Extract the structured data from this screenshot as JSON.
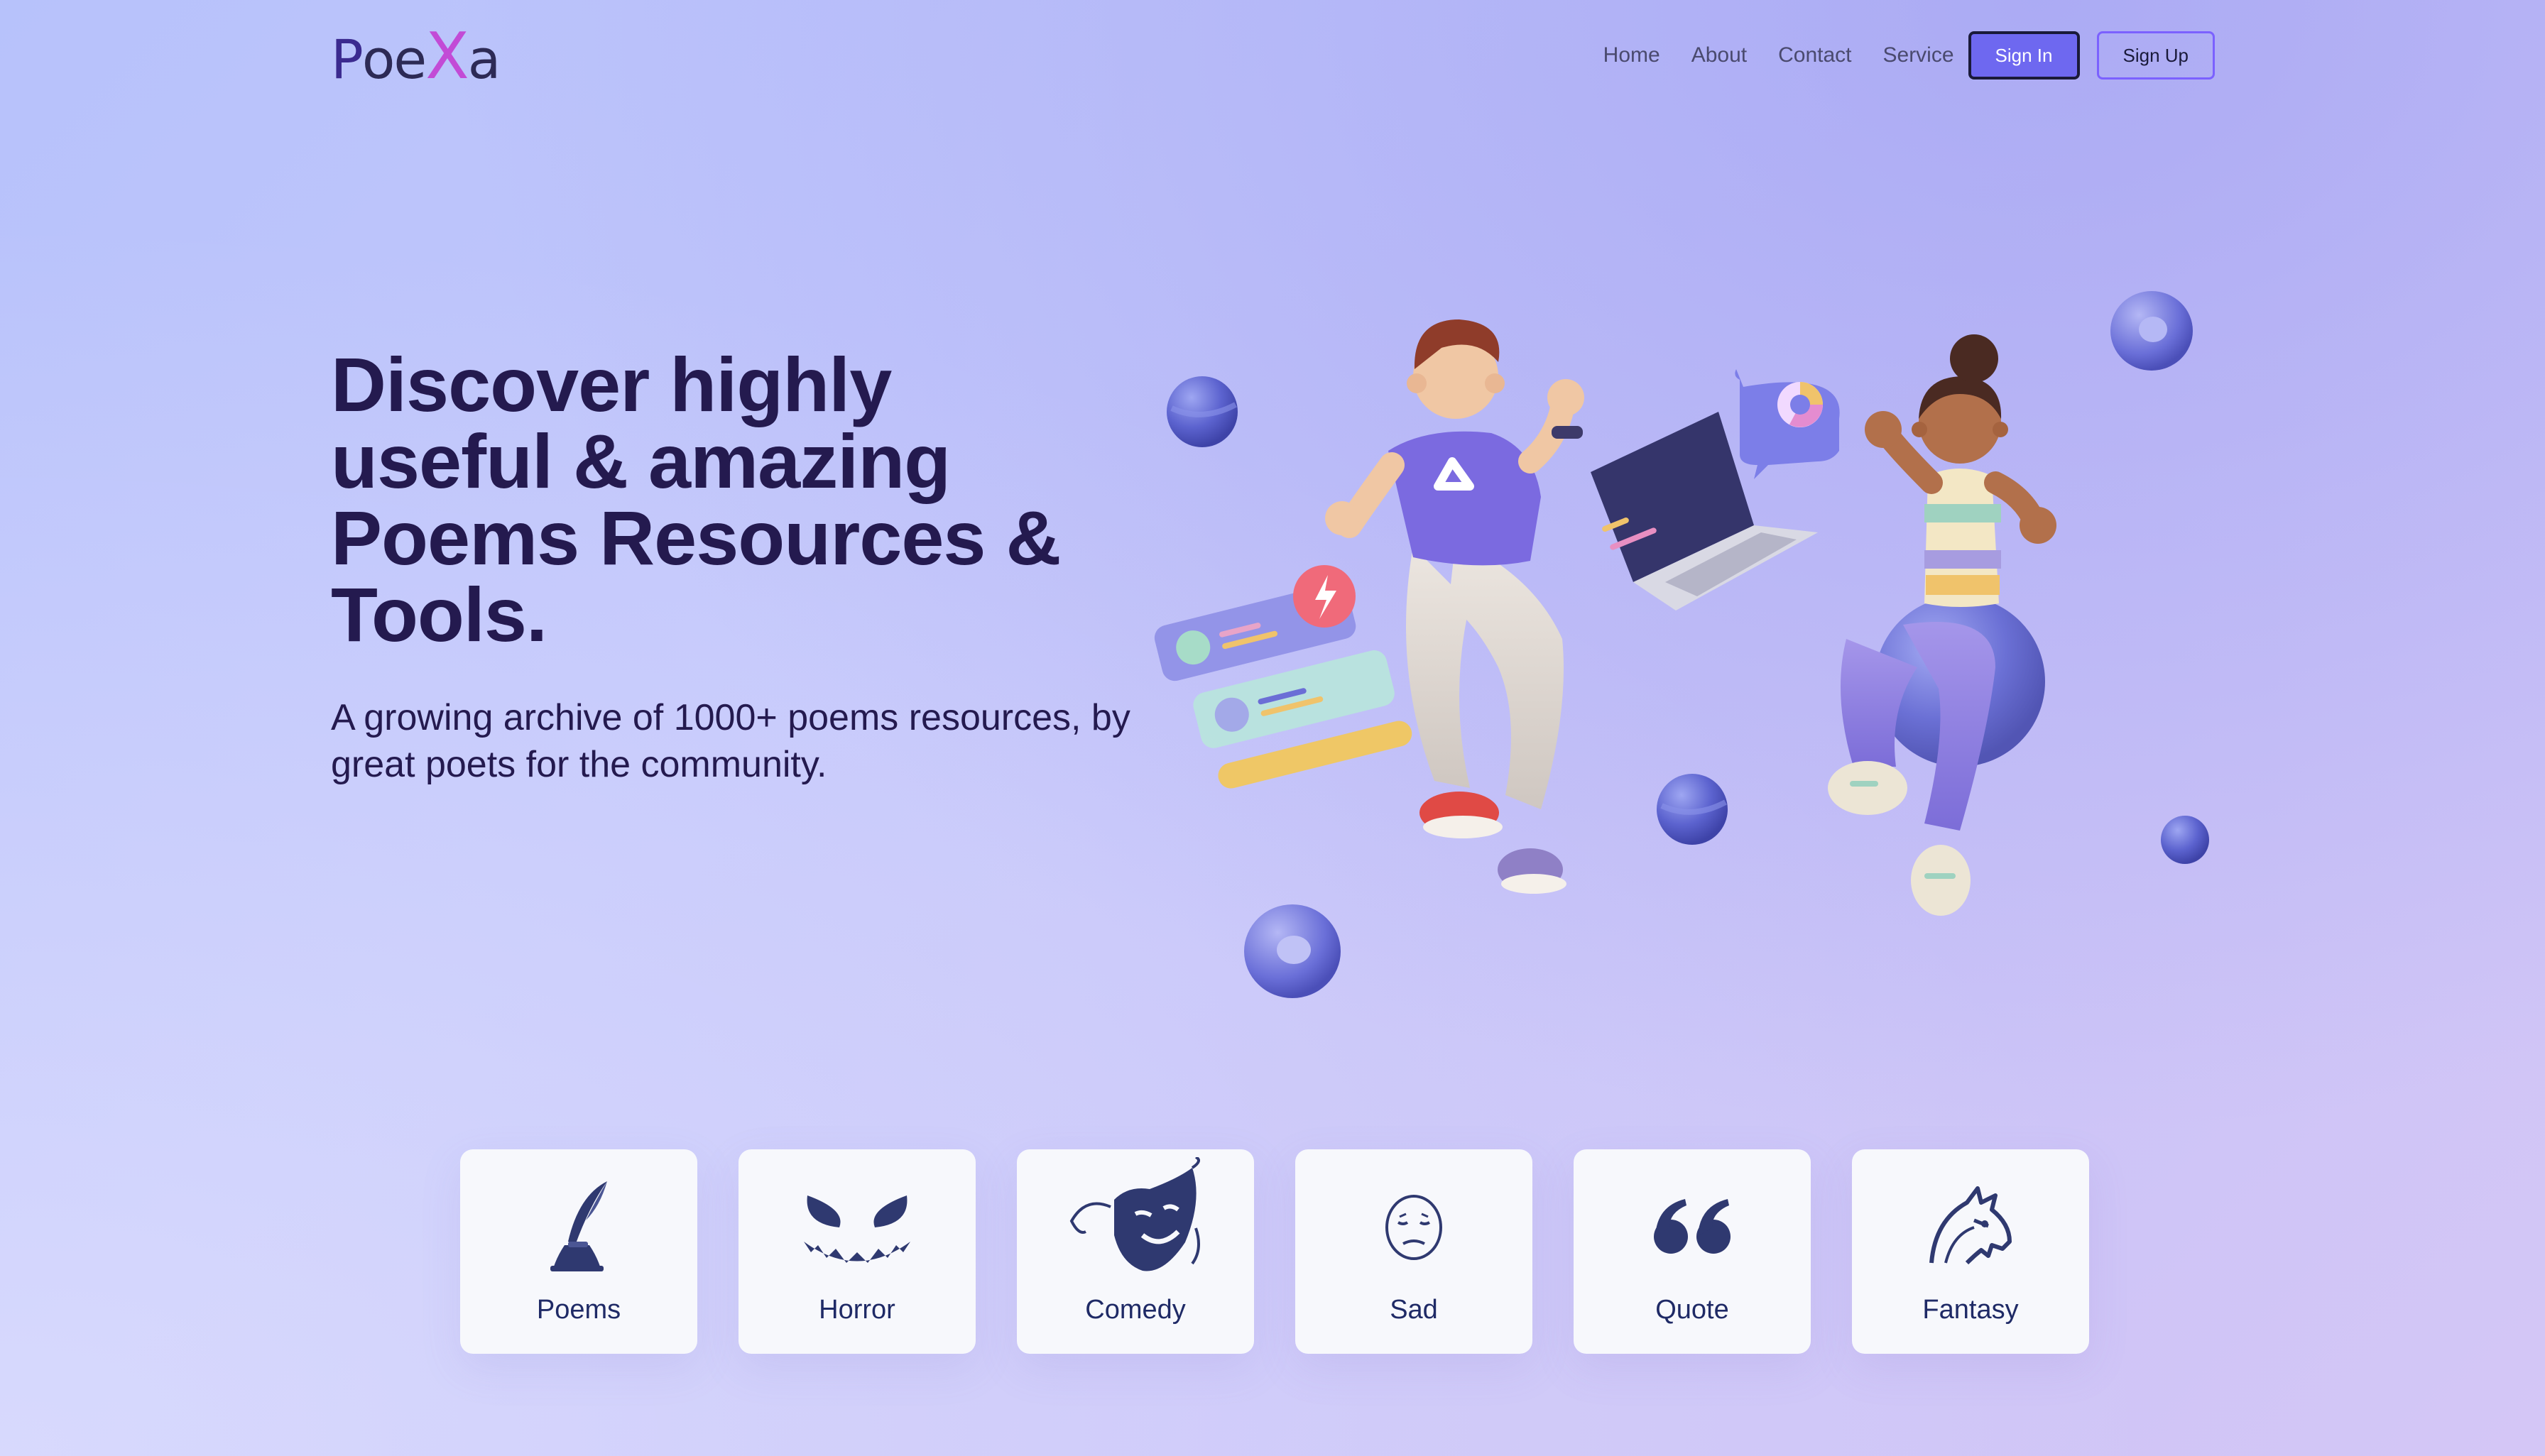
{
  "brand": {
    "logo_parts": [
      "P",
      "oe",
      "X",
      "a"
    ]
  },
  "nav": {
    "links": [
      "Home",
      "About",
      "Contact",
      "Service"
    ],
    "signin_label": "Sign In",
    "signup_label": "Sign Up"
  },
  "hero": {
    "title": "Discover highly useful & amazing Poems Resources & Tools.",
    "subtitle": "A growing archive of 1000+ poems resources, by great poets for the community."
  },
  "categories": [
    {
      "label": "Poems",
      "icon": "quill-ink-icon"
    },
    {
      "label": "Horror",
      "icon": "scary-face-icon"
    },
    {
      "label": "Comedy",
      "icon": "comedy-mask-icon"
    },
    {
      "label": "Sad",
      "icon": "sad-face-icon"
    },
    {
      "label": "Quote",
      "icon": "quote-icon"
    },
    {
      "label": "Fantasy",
      "icon": "dragon-icon"
    }
  ],
  "colors": {
    "accent": "#6e68f0",
    "heading": "#241a4f",
    "card_bg": "#f7f8fc",
    "icon": "#2f3970"
  }
}
